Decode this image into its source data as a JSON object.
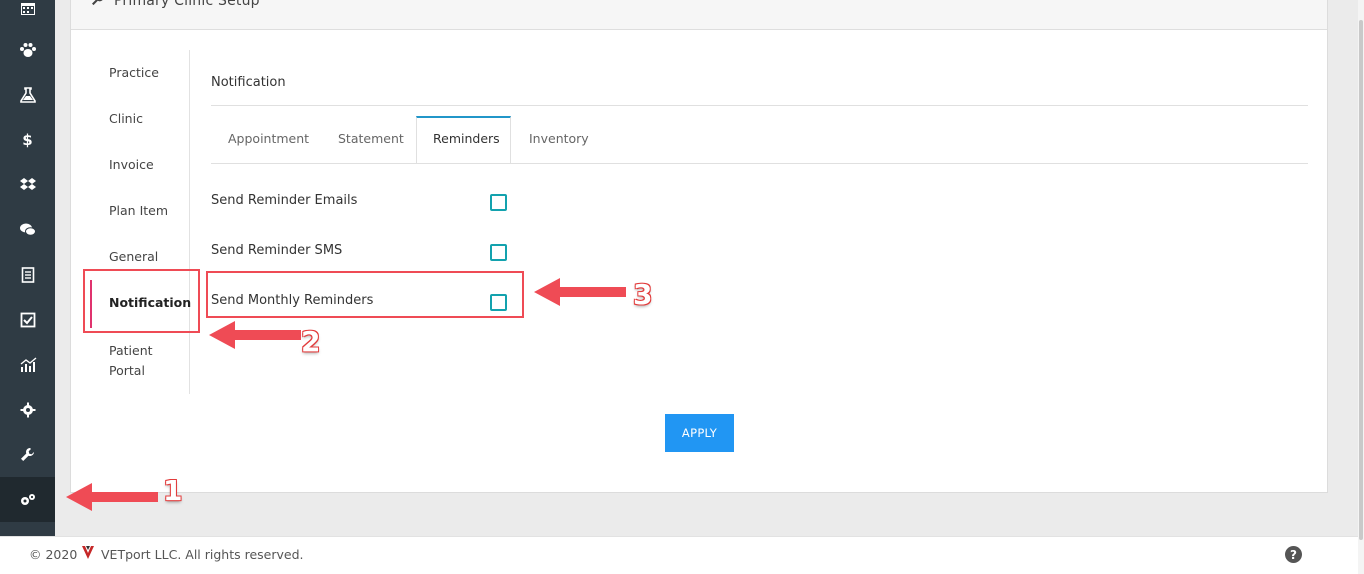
{
  "header": {
    "title": "Primary Clinic Setup"
  },
  "subnav": {
    "items": [
      {
        "label": "Practice"
      },
      {
        "label": "Clinic"
      },
      {
        "label": "Invoice"
      },
      {
        "label": "Plan Item"
      },
      {
        "label": "General"
      },
      {
        "label": "Notification",
        "active": true
      },
      {
        "label": "Patient"
      },
      {
        "label": "Portal"
      }
    ]
  },
  "section": {
    "title": "Notification"
  },
  "tabs": [
    {
      "label": "Appointment"
    },
    {
      "label": "Statement"
    },
    {
      "label": "Reminders",
      "active": true
    },
    {
      "label": "Inventory"
    }
  ],
  "options": [
    {
      "label": "Send Reminder Emails",
      "checked": false
    },
    {
      "label": "Send Reminder SMS",
      "checked": false
    },
    {
      "label": "Send Monthly Reminders",
      "checked": false
    }
  ],
  "apply_label": "APPLY",
  "annotations": {
    "one": "1",
    "two": "2",
    "three": "3"
  },
  "footer": {
    "copyright": "© 2020",
    "company": "VETport LLC. All rights reserved.",
    "help": "?"
  },
  "colors": {
    "accent": "#2196f3",
    "checkbox": "#13a2ae",
    "annotation": "#ef4b55",
    "rail": "#2f3b44"
  },
  "rail_icons": [
    "calendar-icon",
    "paw-icon",
    "flask-icon",
    "dollar-icon",
    "dropbox-icon",
    "chat-icon",
    "document-icon",
    "checklist-icon",
    "chart-icon",
    "gear-icon",
    "wrench-icon",
    "gears-icon"
  ]
}
